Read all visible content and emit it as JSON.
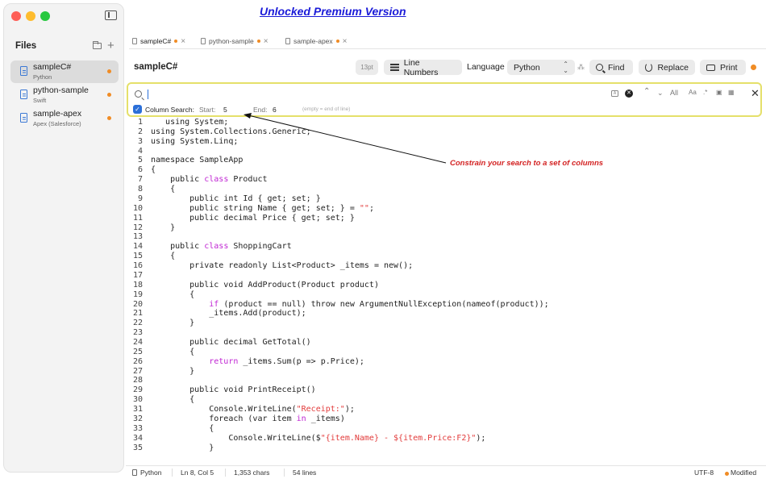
{
  "promo": {
    "link": "Unlocked Premium Version"
  },
  "sidebar": {
    "title": "Files",
    "items": [
      {
        "name": "sampleC#",
        "lang": "Python"
      },
      {
        "name": "python-sample",
        "lang": "Swift"
      },
      {
        "name": "sample-apex",
        "lang": "Apex (Salesforce)"
      }
    ]
  },
  "tabs": [
    {
      "label": "sampleC#"
    },
    {
      "label": "python-sample"
    },
    {
      "label": "sample-apex"
    }
  ],
  "toolbar": {
    "doc_title": "sampleC#",
    "font_size": "13pt",
    "line_numbers": "Line Numbers",
    "language_label": "Language",
    "language_value": "Python",
    "find": "Find",
    "replace": "Replace",
    "print": "Print"
  },
  "search": {
    "value": "",
    "all_label": "All",
    "case_label": "Aa",
    "regex_label": ".*",
    "column_search_label": "Column Search:",
    "start_label": "Start:",
    "start_value": "5",
    "end_label": "End:",
    "end_value": "6",
    "empty_hint": "(empty = end of line)"
  },
  "annotation": "Constrain your search to a set of columns",
  "code": [
    {
      "n": "1",
      "t": "   using System;"
    },
    {
      "n": "2",
      "t": "using System.Collections.Generic;"
    },
    {
      "n": "3",
      "t": "using System.Linq;"
    },
    {
      "n": "4",
      "t": ""
    },
    {
      "n": "5",
      "t": "namespace SampleApp"
    },
    {
      "n": "6",
      "t": "{"
    },
    {
      "n": "7",
      "t": "    public class Product"
    },
    {
      "n": "8",
      "t": "    {"
    },
    {
      "n": "9",
      "t": "        public int Id { get; set; }"
    },
    {
      "n": "10",
      "t": "        public string Name { get; set; } = \"\";"
    },
    {
      "n": "11",
      "t": "        public decimal Price { get; set; }"
    },
    {
      "n": "12",
      "t": "    }"
    },
    {
      "n": "13",
      "t": ""
    },
    {
      "n": "14",
      "t": "    public class ShoppingCart"
    },
    {
      "n": "15",
      "t": "    {"
    },
    {
      "n": "16",
      "t": "        private readonly List<Product> _items = new();"
    },
    {
      "n": "17",
      "t": ""
    },
    {
      "n": "18",
      "t": "        public void AddProduct(Product product)"
    },
    {
      "n": "19",
      "t": "        {"
    },
    {
      "n": "20",
      "t": "            if (product == null) throw new ArgumentNullException(nameof(product));"
    },
    {
      "n": "21",
      "t": "            _items.Add(product);"
    },
    {
      "n": "22",
      "t": "        }"
    },
    {
      "n": "23",
      "t": ""
    },
    {
      "n": "24",
      "t": "        public decimal GetTotal()"
    },
    {
      "n": "25",
      "t": "        {"
    },
    {
      "n": "26",
      "t": "            return _items.Sum(p => p.Price);"
    },
    {
      "n": "27",
      "t": "        }"
    },
    {
      "n": "28",
      "t": ""
    },
    {
      "n": "29",
      "t": "        public void PrintReceipt()"
    },
    {
      "n": "30",
      "t": "        {"
    },
    {
      "n": "31",
      "t": "            Console.WriteLine(\"Receipt:\");"
    },
    {
      "n": "32",
      "t": "            foreach (var item in _items)"
    },
    {
      "n": "33",
      "t": "            {"
    },
    {
      "n": "34",
      "t": "                Console.WriteLine($\"{item.Name} - ${item.Price:F2}\");"
    },
    {
      "n": "35",
      "t": "            }"
    }
  ],
  "status_bar": {
    "language": "Python",
    "position": "Ln 8, Col 5",
    "chars": "1,353 chars",
    "lines": "54 lines",
    "encoding": "UTF-8",
    "state": "Modified"
  },
  "colors": {
    "accent": "#2b6fd8",
    "modified_dot": "#f08c25",
    "search_border": "#e5e06a",
    "keyword": "#c026d3",
    "string": "#e23b3b",
    "annotation": "#d32222"
  }
}
